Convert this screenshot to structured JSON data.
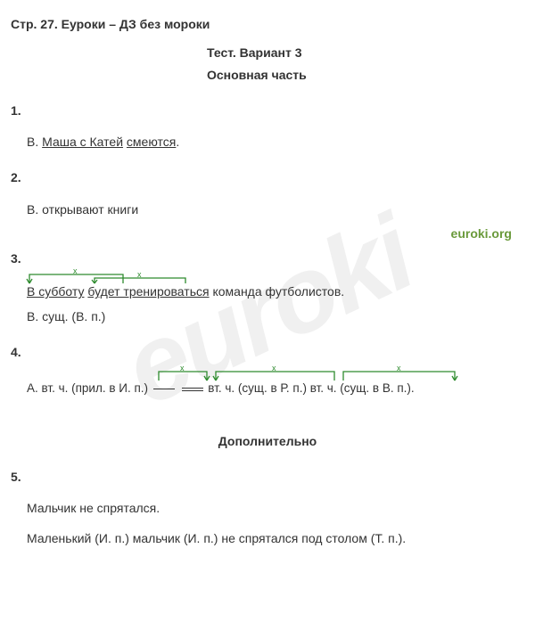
{
  "header": {
    "crumb": "Стр. 27. Еуроки – ДЗ без мороки",
    "subtitle": "Тест. Вариант 3",
    "section": "Основная часть"
  },
  "watermark": "euroki",
  "brand": "euroki.org",
  "q1": {
    "num": "1.",
    "letter": "В. ",
    "p1": "Маша с Катей",
    "sp": " ",
    "p2": "смеются",
    "end": "."
  },
  "q2": {
    "num": "2.",
    "text": "В. открывают книги"
  },
  "q3": {
    "num": "3.",
    "w1": "В субботу",
    "sp1": " ",
    "w2": "будет тренироваться",
    "rest": " команда футболистов.",
    "ans": "В. сущ. (В. п.)"
  },
  "q4": {
    "num": "4.",
    "a": "А. вт. ч. (прил. в И. п.) ",
    "b": " вт. ч. (сущ. в Р. п.) ",
    "c": " вт. ч. (сущ. в В. п.)."
  },
  "extra": {
    "title": "Дополнительно",
    "num": "5.",
    "l1": "Мальчик не спрятался.",
    "l2": "Маленький (И. п.) мальчик (И. п.) не спрятался под столом (Т. п.)."
  }
}
